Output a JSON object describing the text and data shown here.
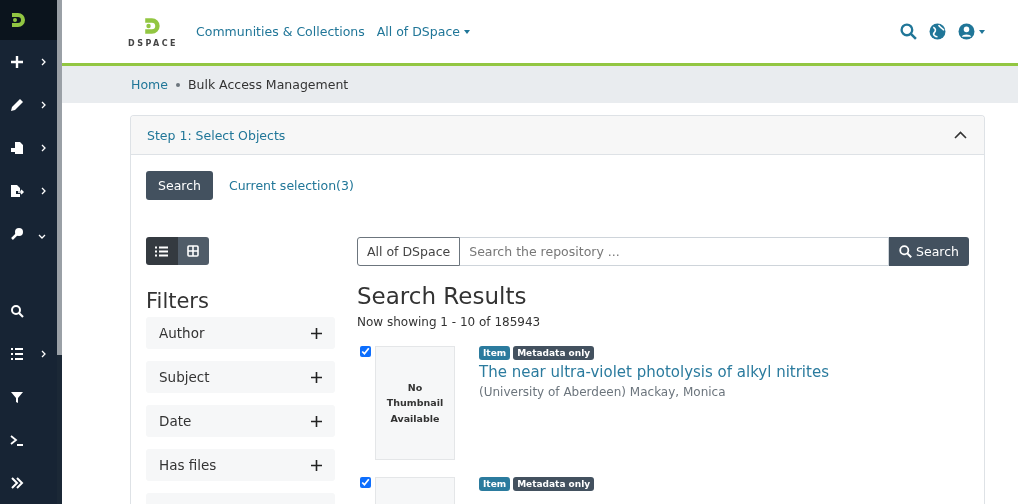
{
  "sidebar": {
    "items": [
      {
        "kind": "menu",
        "expanded": false
      },
      {
        "kind": "menu",
        "expanded": false
      },
      {
        "kind": "menu",
        "expanded": false
      },
      {
        "kind": "menu",
        "expanded": false
      },
      {
        "kind": "menu",
        "expanded": true
      },
      {
        "kind": "link"
      },
      {
        "kind": "menu",
        "expanded": false
      },
      {
        "kind": "link"
      },
      {
        "kind": "link"
      },
      {
        "kind": "link"
      }
    ]
  },
  "header": {
    "logo": "DSPACE",
    "nav": [
      {
        "label": "Communities & Collections",
        "dropdown": false
      },
      {
        "label": "All of DSpace",
        "dropdown": true
      }
    ]
  },
  "breadcrumb": [
    "Home",
    "Bulk Access Management"
  ],
  "step": {
    "title": "Step 1: Select Objects",
    "expanded": true,
    "tabs": [
      {
        "label": "Search",
        "selected": true
      },
      {
        "label": "Current selection(3)",
        "selected": false
      }
    ],
    "view_modes": [
      {
        "selected": true
      },
      {
        "selected": false
      }
    ],
    "filters": {
      "title": "Filters",
      "items": [
        "Author",
        "Subject",
        "Date",
        "Has files"
      ]
    },
    "search": {
      "scope": "All of DSpace",
      "placeholder": "Search the repository ...",
      "button": "Search"
    },
    "results": {
      "title": "Search Results",
      "count": "Now showing 1 - 10 of 185943",
      "items": [
        {
          "selected": true,
          "thumbnail": "No Thumbnail Available",
          "badges": [
            {
              "label": "Item",
              "kind": "type"
            },
            {
              "label": "Metadata only",
              "kind": "access"
            }
          ],
          "title": "The near ultra-violet photolysis of alkyl nitrites",
          "authors": "(University of Aberdeen) Mackay, Monica"
        },
        {
          "selected": true,
          "badges": [
            {
              "label": "Item",
              "kind": "type"
            },
            {
              "label": "Metadata only",
              "kind": "access"
            }
          ]
        }
      ]
    }
  }
}
